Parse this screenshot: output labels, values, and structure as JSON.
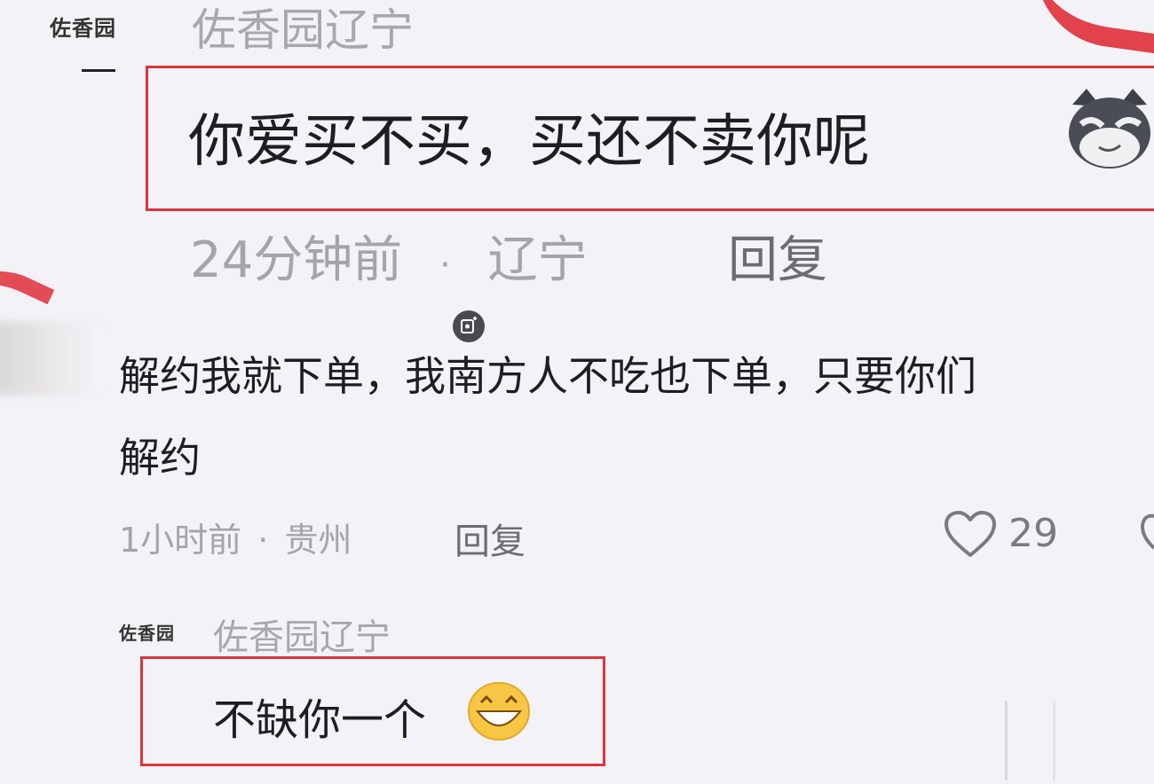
{
  "comment1": {
    "avatar_text": "佐香园",
    "username": "佐香园辽宁",
    "content": "你爱买不买，买还不卖你呢",
    "emoji": "cat-smirk-icon",
    "time": "24分钟前",
    "separator": "·",
    "location": "辽宁",
    "reply_label": "回复"
  },
  "comment2": {
    "content_line1": "解约我就下单，我南方人不吃也下单，只要你们",
    "content_line2": "解约",
    "time": "1小时前",
    "separator": "·",
    "location": "贵州",
    "reply_label": "回复",
    "like_count": "29"
  },
  "comment3": {
    "avatar_text": "佐香园",
    "username": "佐香园辽宁",
    "content": "不缺你一个",
    "emoji": "grinning-face-icon"
  },
  "colors": {
    "highlight_border": "#e0333b",
    "background": "#f3f2f6"
  }
}
